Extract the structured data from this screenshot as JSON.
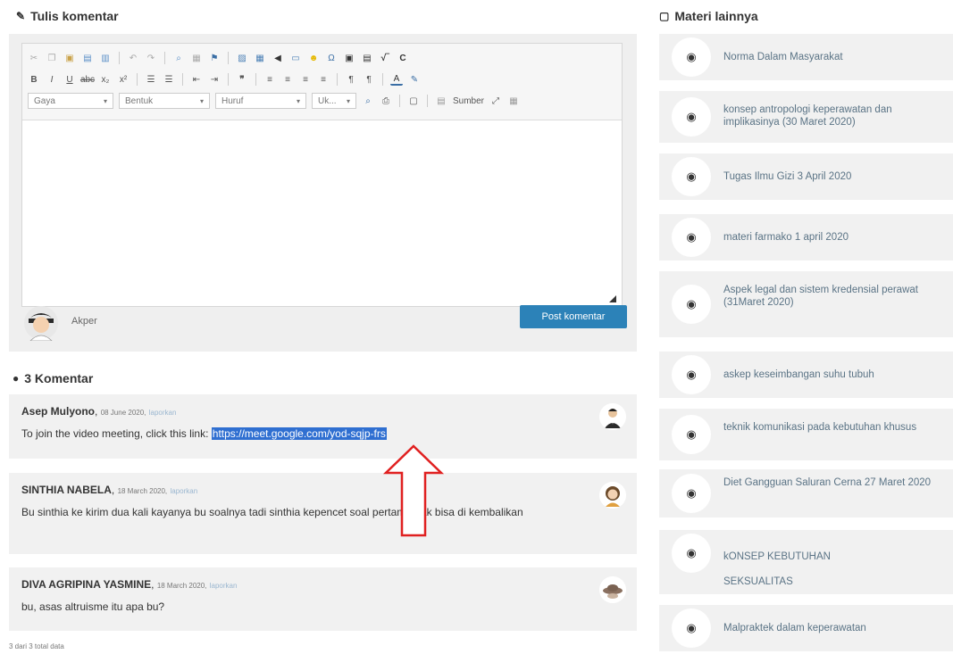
{
  "comment_form": {
    "title": "Tulis komentar",
    "combos": [
      "Gaya",
      "Bentuk",
      "Huruf",
      "Uk..."
    ],
    "source_label": "Sumber",
    "user_name": "Akper",
    "post_button": "Post komentar"
  },
  "comments_section": {
    "title": "3 Komentar",
    "comments": [
      {
        "author": "Asep Mulyono",
        "date": "08 June 2020,",
        "action": "laporkan",
        "text_before_link": "To join the video meeting, click this link: ",
        "link": "https://meet.google.com/yod-sqjp-frs"
      },
      {
        "author": "SINTHIA NABELA",
        "date": "18 March 2020,",
        "action": "laporkan",
        "text": "Bu sinthia ke kirim dua kali kayanya bu soalnya tadi sinthia kepencet soal pertama gak bisa di kembalikan"
      },
      {
        "author": "DIVA AGRIPINA YASMINE",
        "date": "18 March 2020,",
        "action": "laporkan",
        "text": "bu, asas altruisme itu apa bu?"
      }
    ],
    "total_text": "3 dari 3 total data"
  },
  "sidebar": {
    "title": "Materi lainnya",
    "items": [
      "Norma Dalam Masyarakat",
      "konsep antropologi keperawatan dan implikasinya (30 Maret 2020)",
      "Tugas Ilmu Gizi 3 April 2020",
      "materi farmako 1 april 2020",
      "Aspek legal dan sistem kredensial perawat (31Maret 2020)",
      "askep keseimbangan suhu tubuh",
      "teknik komunikasi pada kebutuhan khusus",
      "Diet Gangguan Saluran Cerna 27 Maret 2020",
      "kONSEP KEBUTUHAN SEKSUALITAS",
      "Malpraktek dalam keperawatan"
    ]
  },
  "colors": {
    "post_button": "#2c82b8",
    "link_highlight": "#2f6fd1",
    "arrow": "#e02020"
  }
}
